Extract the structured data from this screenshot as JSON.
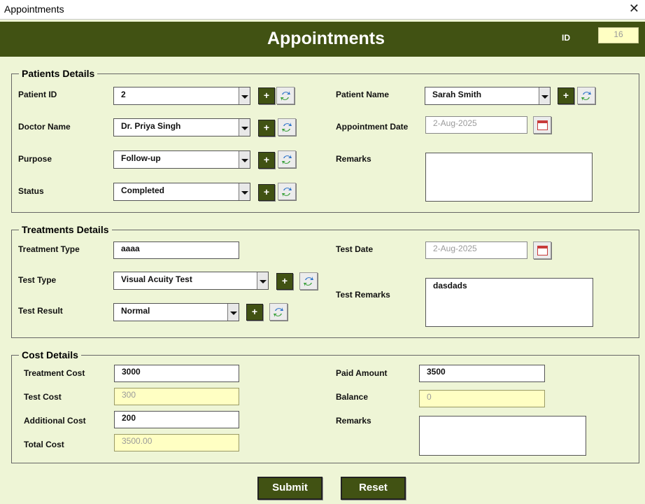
{
  "window": {
    "title": "Appointments"
  },
  "header": {
    "title": "Appointments",
    "id_label": "ID",
    "id_value": "16"
  },
  "patients": {
    "legend": "Patients Details",
    "patient_id_label": "Patient ID",
    "patient_id": "2",
    "patient_name_label": "Patient Name",
    "patient_name": "Sarah Smith",
    "doctor_label": "Doctor Name",
    "doctor": "Dr. Priya Singh",
    "appt_date_label": "Appointment Date",
    "appt_date": "2-Aug-2025",
    "purpose_label": "Purpose",
    "purpose": "Follow-up",
    "remarks_label": "Remarks",
    "remarks": "",
    "status_label": "Status",
    "status": "Completed"
  },
  "treatments": {
    "legend": "Treatments Details",
    "treatment_type_label": "Treatment Type",
    "treatment_type": "aaaa",
    "test_date_label": "Test Date",
    "test_date": "2-Aug-2025",
    "test_type_label": "Test Type",
    "test_type": "Visual Acuity Test",
    "test_remarks_label": "Test Remarks",
    "test_remarks": "dasdads",
    "test_result_label": "Test Result",
    "test_result": "Normal"
  },
  "cost": {
    "legend": "Cost Details",
    "treatment_cost_label": "Treatment Cost",
    "treatment_cost": "3000",
    "paid_label": "Paid Amount",
    "paid": "3500",
    "test_cost_label": "Test Cost",
    "test_cost": "300",
    "balance_label": "Balance",
    "balance": "0",
    "additional_label": "Additional Cost",
    "additional": "200",
    "remarks_label": "Remarks",
    "remarks": "",
    "total_label": "Total Cost",
    "total": "3500.00"
  },
  "buttons": {
    "add": "+",
    "submit": "Submit",
    "reset": "Reset"
  },
  "colors": {
    "header": "#415213",
    "background": "#eef5d6",
    "readonly": "#ffffc3"
  }
}
